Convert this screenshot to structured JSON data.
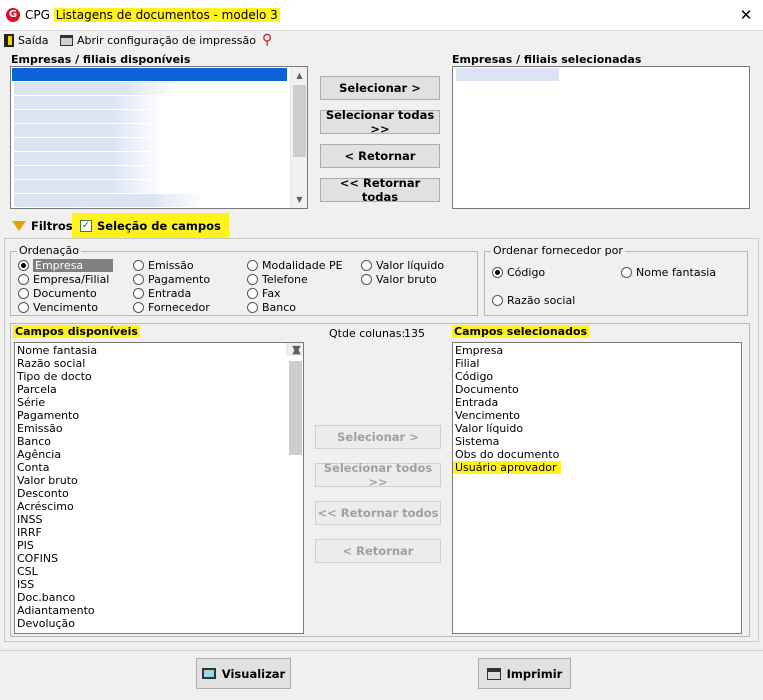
{
  "window": {
    "app_name": "CPG",
    "title": "Listagens de documentos - modelo 3",
    "close": "✕"
  },
  "toolbar": {
    "exit_label": "Saída",
    "print_config_label": "Abrir configuração de impressão"
  },
  "companies": {
    "available_label": "Empresas / filiais disponíveis",
    "selected_label": "Empresas / filiais selecionadas",
    "buttons": {
      "select": "Selecionar >",
      "select_all": "Selecionar todas >>",
      "return": "< Retornar",
      "return_all": "<< Retornar todas"
    }
  },
  "tabs": {
    "filters": "Filtros",
    "field_selection": "Seleção de campos"
  },
  "ordering": {
    "title": "Ordenação",
    "options": [
      "Empresa",
      "Empresa/Filial",
      "Documento",
      "Vencimento",
      "Emissão",
      "Pagamento",
      "Entrada",
      "Fornecedor",
      "Modalidade PE",
      "Telefone",
      "Fax",
      "Banco",
      "Valor líquido",
      "Valor bruto"
    ],
    "selected": "Empresa"
  },
  "supplier_order": {
    "title": "Ordenar fornecedor por",
    "options": [
      "Código",
      "Nome fantasia",
      "Razão social"
    ],
    "selected": "Código"
  },
  "fields": {
    "available_label": "Campos disponíveis",
    "selected_label": "Campos selecionados",
    "count_label": "Qtde colunas:",
    "count_value": "135",
    "available": [
      "Nome fantasia",
      "Razão social",
      "Tipo de docto",
      "Parcela",
      "Série",
      "Pagamento",
      "Emissão",
      "Banco",
      "Agência",
      "Conta",
      "Valor bruto",
      "Desconto",
      "Acréscimo",
      "INSS",
      "IRRF",
      "PIS",
      "COFINS",
      "CSL",
      "ISS",
      "Doc.banco",
      "Adiantamento",
      "Devolução"
    ],
    "selected": [
      "Empresa",
      "Filial",
      "Código",
      "Documento",
      "Entrada",
      "Vencimento",
      "Valor líquido",
      "Sistema",
      "Obs do documento",
      "Usuário aprovador"
    ],
    "buttons": {
      "select": "Selecionar >",
      "select_all": "Selecionar todos >>",
      "return_all": "<< Retornar todos",
      "return": "< Retornar"
    }
  },
  "footer": {
    "view_label": "Visualizar",
    "print_label": "Imprimir"
  }
}
